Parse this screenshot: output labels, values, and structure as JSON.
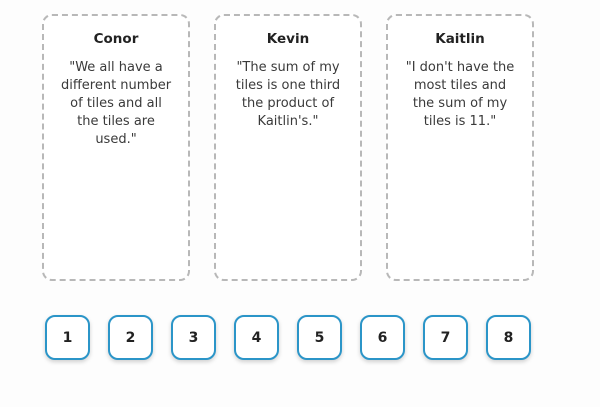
{
  "cards": [
    {
      "name": "Conor",
      "quote": "\"We all have a different number of tiles and all the tiles are used.\""
    },
    {
      "name": "Kevin",
      "quote": "\"The sum of my tiles is one third the product of Kaitlin's.\""
    },
    {
      "name": "Kaitlin",
      "quote": "\"I don't have the most tiles and the sum of my tiles is 11.\""
    }
  ],
  "tiles": [
    "1",
    "2",
    "3",
    "4",
    "5",
    "6",
    "7",
    "8"
  ],
  "colors": {
    "tile_border": "#2b95c8",
    "card_border": "#b8b8b8"
  }
}
